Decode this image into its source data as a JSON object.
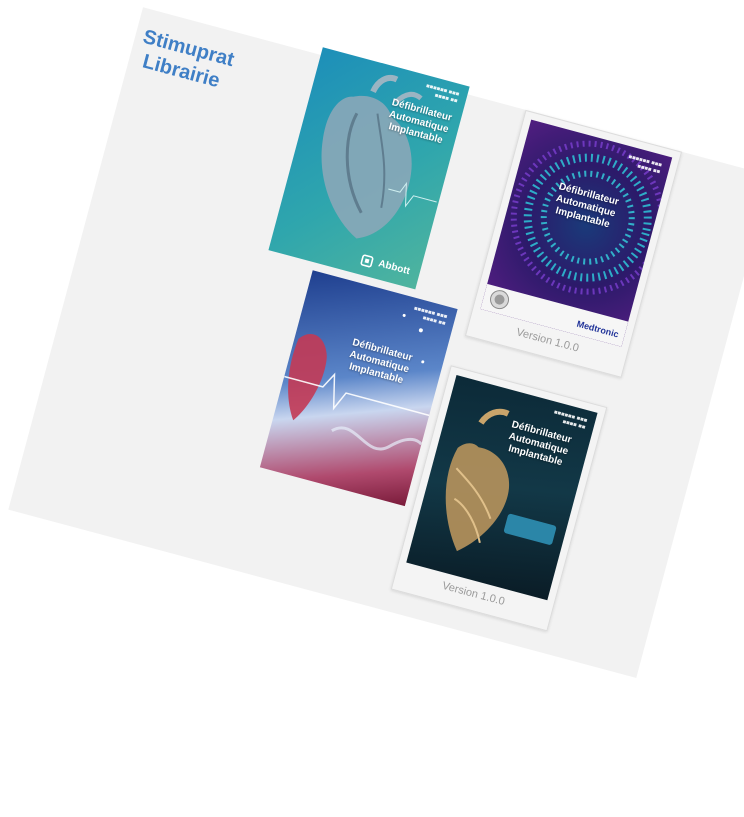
{
  "library": {
    "title_line1": "Stimuprat",
    "title_line2": "Librairie"
  },
  "books": [
    {
      "title": "Défibrillateur Automatique Implantable",
      "brand": "Abbott",
      "version": ""
    },
    {
      "title": "Défibrillateur Automatique Implantable",
      "brand": "Medtronic",
      "version": "Version 1.0.0"
    },
    {
      "title": "Défibrillateur Automatique Implantable",
      "brand": "",
      "version": ""
    },
    {
      "title": "Défibrillateur Automatique Implantable",
      "brand": "",
      "version": "Version 1.0.0"
    }
  ],
  "colors": {
    "accent": "#3f7fc6",
    "panel": "#f2f2f2",
    "version_text": "#9a9a9a"
  }
}
